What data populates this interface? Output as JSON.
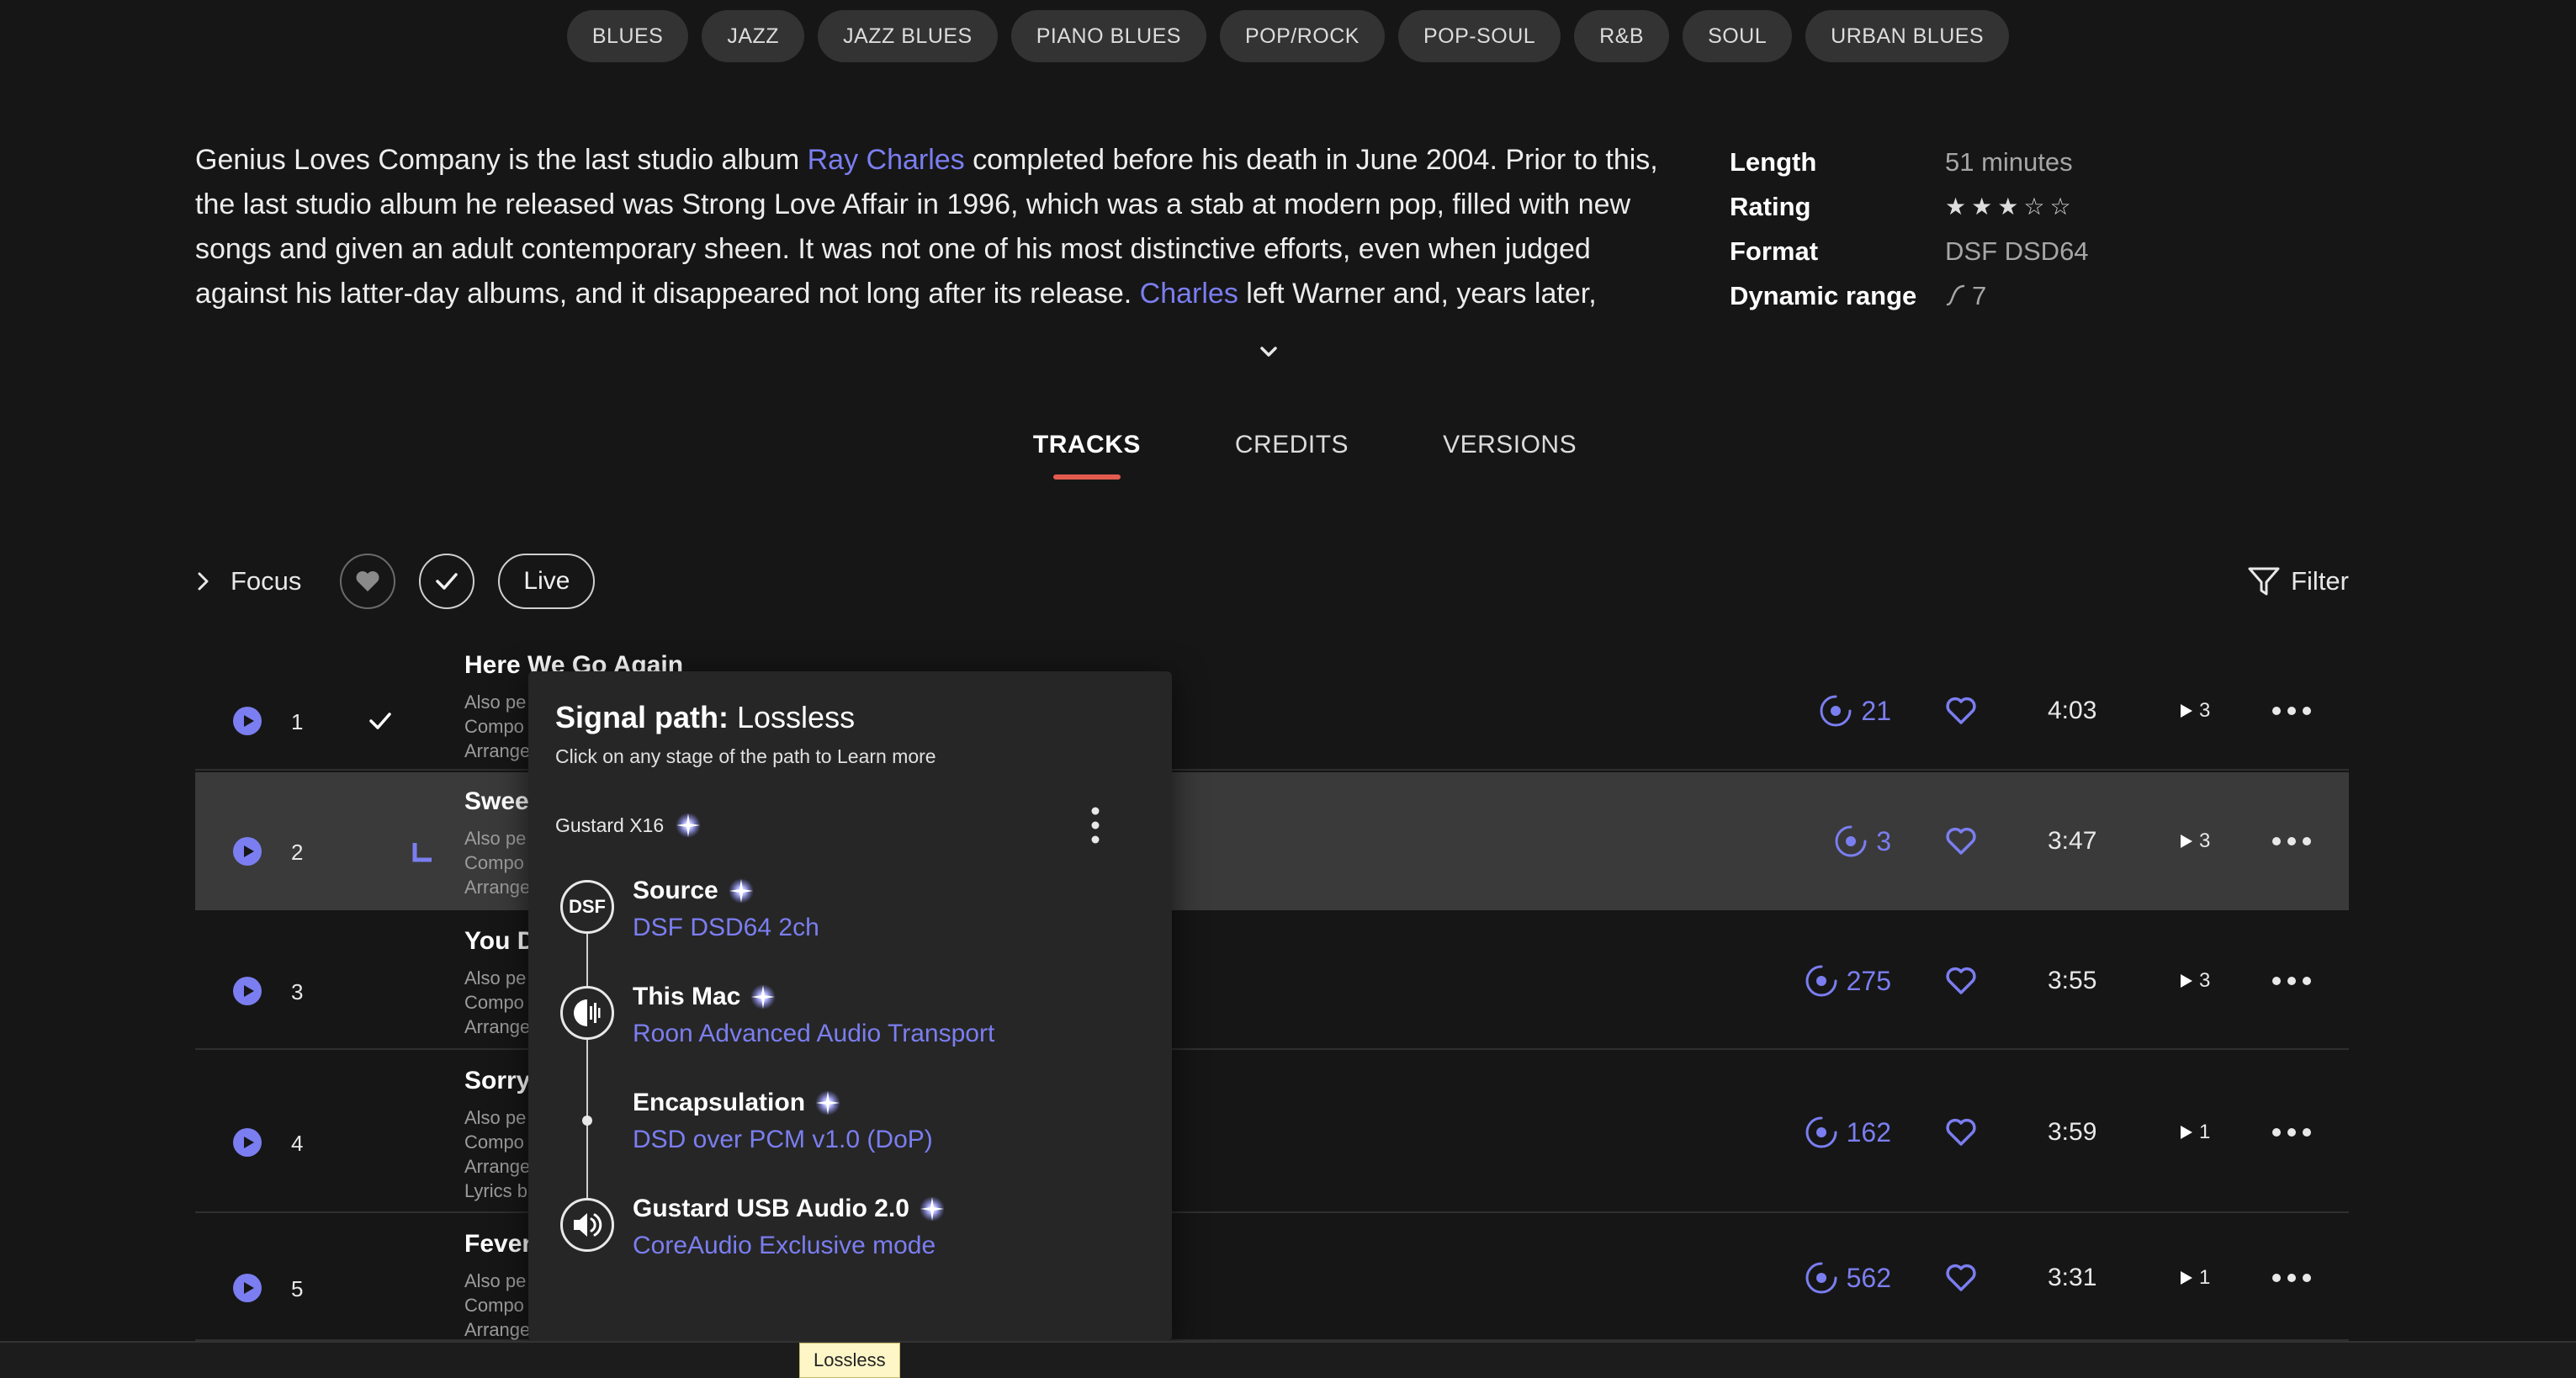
{
  "genres": [
    "BLUES",
    "JAZZ",
    "JAZZ BLUES",
    "PIANO BLUES",
    "POP/ROCK",
    "POP-SOUL",
    "R&B",
    "SOUL",
    "URBAN BLUES"
  ],
  "description": {
    "p1": "Genius Loves Company is the last studio album ",
    "link1": "Ray Charles",
    "p2": " completed before his death in June 2004. Prior to this, the last studio album he released was Strong Love Affair in 1996, which was a stab at modern pop, filled with new songs and given an adult contemporary sheen. It was not one of his most distinctive efforts, even when judged against his latter-day albums, and it disappeared not long after its release. ",
    "link2": "Charles",
    "p3": " left Warner and, years later,"
  },
  "meta": {
    "length_label": "Length",
    "length_value": "51 minutes",
    "rating_label": "Rating",
    "rating_value": 3,
    "rating_max": 5,
    "format_label": "Format",
    "format_value": "DSF DSD64",
    "dr_label": "Dynamic range",
    "dr_value": "7"
  },
  "tabs": [
    "TRACKS",
    "CREDITS",
    "VERSIONS"
  ],
  "toolbar": {
    "focus_label": "Focus",
    "live_label": "Live",
    "filter_label": "Filter"
  },
  "tracks": [
    {
      "num": "1",
      "title": "Here We Go Again",
      "sub": [
        "Also pe",
        "Compo",
        "Arrange"
      ],
      "plays": "21",
      "duration": "4:03",
      "play_count": "3"
    },
    {
      "num": "2",
      "title": "Sweet",
      "sub": [
        "Also pe",
        "Compo",
        "Arrange"
      ],
      "plays": "3",
      "duration": "3:47",
      "play_count": "3"
    },
    {
      "num": "3",
      "title": "You D",
      "sub": [
        "Also pe",
        "Compo",
        "Arrange"
      ],
      "plays": "275",
      "duration": "3:55",
      "play_count": "3"
    },
    {
      "num": "4",
      "title": "Sorry",
      "sub": [
        "Also pe",
        "Compo",
        "Arrange",
        "Lyrics b"
      ],
      "plays": "162",
      "duration": "3:59",
      "play_count": "1"
    },
    {
      "num": "5",
      "title": "Fever",
      "sub": [
        "Also pe",
        "Compo",
        "Arrange"
      ],
      "plays": "562",
      "duration": "3:31",
      "play_count": "1"
    }
  ],
  "signal_path": {
    "title_bold": "Signal path:",
    "title_rest": " Lossless",
    "subtitle": "Click on any stage of the path to Learn more",
    "zone": "Gustard X16",
    "source_icon_text": "DSF",
    "stages": [
      {
        "name": "Source",
        "value": "DSF DSD64 2ch"
      },
      {
        "name": "This Mac",
        "value": "Roon Advanced Audio Transport"
      },
      {
        "name": "Encapsulation",
        "value": "DSD over PCM v1.0 (DoP)"
      },
      {
        "name": "Gustard USB Audio 2.0",
        "value": "CoreAudio Exclusive mode"
      }
    ]
  },
  "tooltip": "Lossless",
  "colors": {
    "accent": "#7b7ef0",
    "tab_underline": "#e35b4f",
    "background": "#161616",
    "popup": "#262626"
  }
}
